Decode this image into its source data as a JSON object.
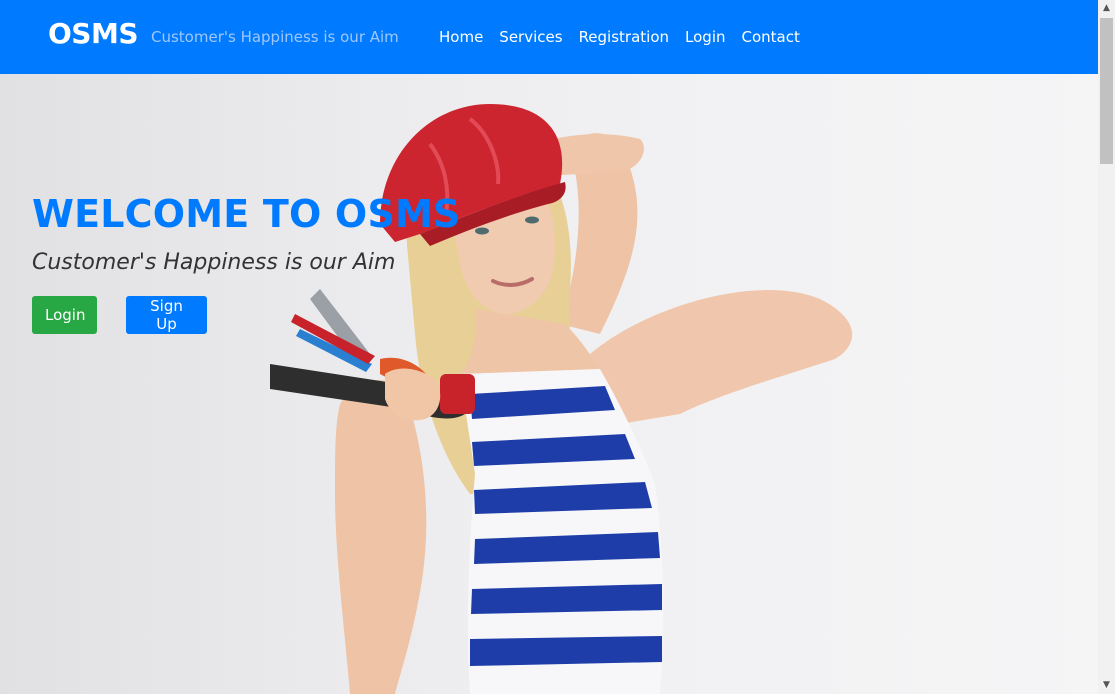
{
  "navbar": {
    "brand": "OSMS",
    "tagline": "Customer's Happiness is our Aim",
    "links": [
      "Home",
      "Services",
      "Registration",
      "Login",
      "Contact"
    ]
  },
  "hero": {
    "title": "WELCOME TO OSMS",
    "subtitle": "Customer's Happiness is our Aim",
    "login_button": "Login",
    "signup_button": "Sign Up",
    "image_description_icon": "technician-woman-photo"
  },
  "colors": {
    "primary": "#007bff",
    "success": "#28a745",
    "text": "#333333"
  }
}
